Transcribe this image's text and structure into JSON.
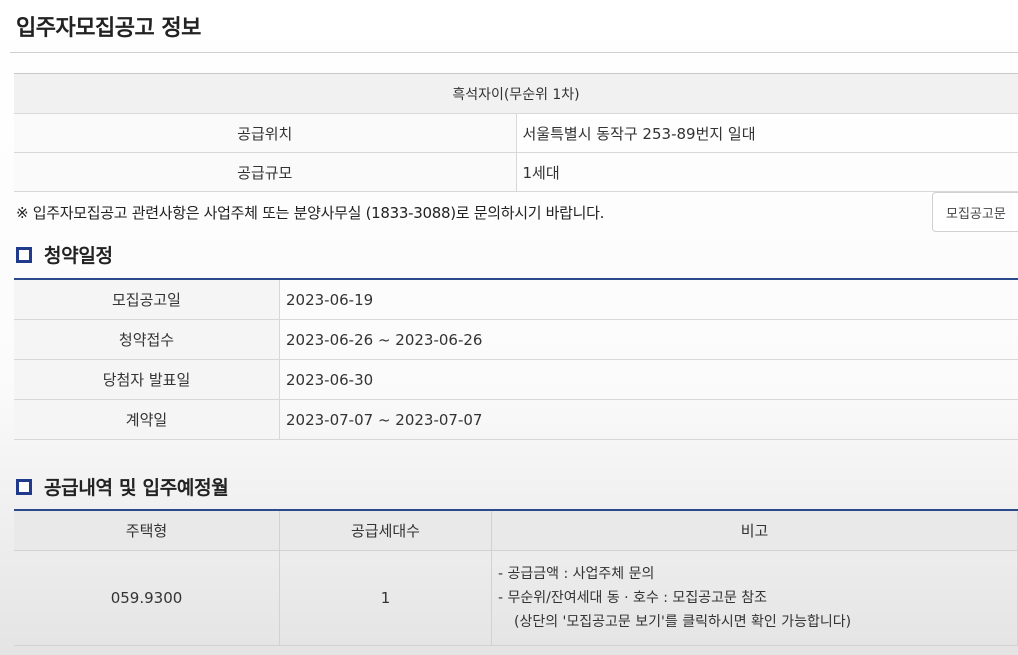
{
  "page": {
    "title": "입주자모집공고 정보"
  },
  "info": {
    "header": "흑석자이(무순위 1차)",
    "rows": [
      {
        "label": "공급위치",
        "value": "서울특별시 동작구 253-89번지 일대"
      },
      {
        "label": "공급규모",
        "value": "1세대"
      }
    ]
  },
  "notice": {
    "text": "※ 입주자모집공고 관련사항은 사업주체 또는 분양사무실 (1833-3088)로 문의하시기 바랍니다.",
    "button_label": "모집공고문"
  },
  "schedule": {
    "title": "청약일정",
    "rows": [
      {
        "label": "모집공고일",
        "value": "2023-06-19"
      },
      {
        "label": "청약접수",
        "value": "2023-06-26 ~ 2023-06-26"
      },
      {
        "label": "당첨자 발표일",
        "value": "2023-06-30"
      },
      {
        "label": "계약일",
        "value": "2023-07-07 ~ 2023-07-07"
      }
    ]
  },
  "supply": {
    "title": "공급내역 및 입주예정월",
    "headers": [
      "주택형",
      "공급세대수",
      "비고"
    ],
    "rows": [
      {
        "type": "059.9300",
        "count": "1",
        "notes": [
          "-  공급금액 : 사업주체 문의",
          "-  무순위/잔여세대 동 · 호수 : 모집공고문 참조",
          "(상단의 '모집공고문 보기'를 클릭하시면 확인 가능합니다)"
        ]
      }
    ]
  },
  "colors": {
    "accent": "#2a4a8c",
    "icon": "#1f3a8a"
  }
}
